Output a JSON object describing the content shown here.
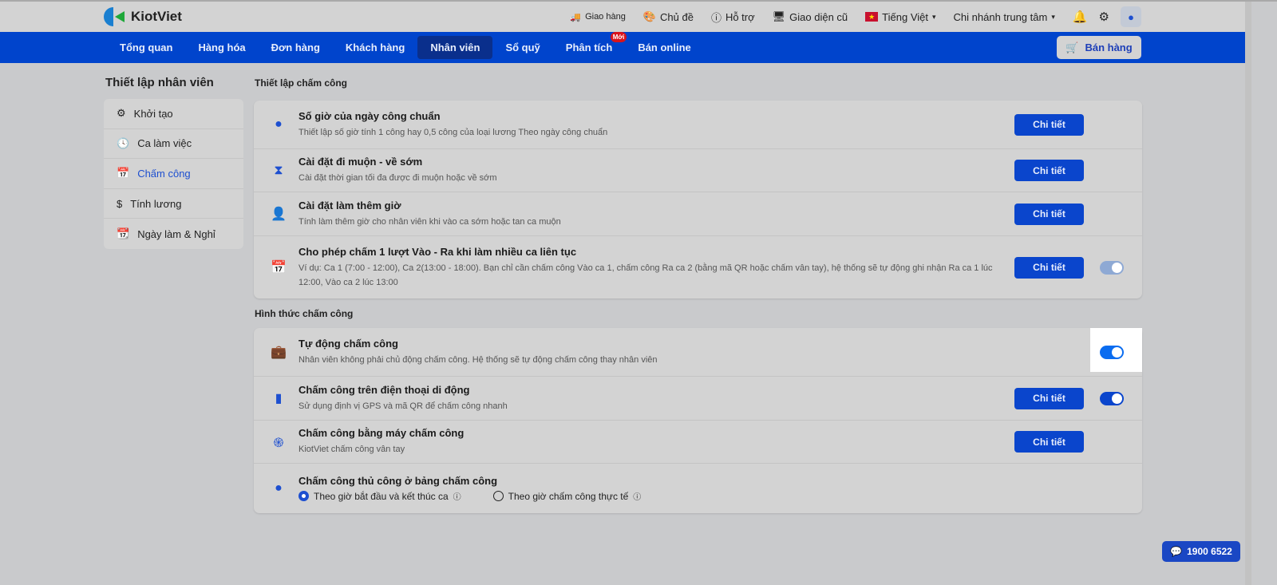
{
  "header": {
    "brand": "KiotViet",
    "delivery": "Giao hàng",
    "theme": "Chủ đề",
    "support": "Hỗ trợ",
    "old_ui": "Giao diện cũ",
    "language": "Tiếng Việt",
    "branch": "Chi nhánh trung tâm"
  },
  "nav": {
    "items": [
      {
        "label": "Tổng quan"
      },
      {
        "label": "Hàng hóa"
      },
      {
        "label": "Đơn hàng"
      },
      {
        "label": "Khách hàng"
      },
      {
        "label": "Nhân viên",
        "active": true
      },
      {
        "label": "Sổ quỹ"
      },
      {
        "label": "Phân tích",
        "badge": "Mới"
      },
      {
        "label": "Bán online"
      }
    ],
    "sell_button": "Bán hàng"
  },
  "sidebar": {
    "title": "Thiết lập nhân viên",
    "items": [
      {
        "label": "Khởi tạo"
      },
      {
        "label": "Ca làm việc"
      },
      {
        "label": "Chấm công",
        "active": true
      },
      {
        "label": "Tính lương"
      },
      {
        "label": "Ngày làm & Nghỉ"
      }
    ]
  },
  "section1": {
    "title": "Thiết lập chấm công",
    "rows": [
      {
        "title": "Số giờ của ngày công chuẩn",
        "desc": "Thiết lập số giờ tính 1 công hay 0,5 công của loại lương Theo ngày công chuẩn",
        "button": "Chi tiết"
      },
      {
        "title": "Cài đặt đi muộn - về sớm",
        "desc": "Cài đặt thời gian tối đa được đi muộn hoặc về sớm",
        "button": "Chi tiết"
      },
      {
        "title": "Cài đặt làm thêm giờ",
        "desc": "Tính làm thêm giờ cho nhân viên khi vào ca sớm hoặc tan ca muộn",
        "button": "Chi tiết"
      },
      {
        "title": "Cho phép chấm 1 lượt Vào - Ra khi làm nhiều ca liên tục",
        "desc": "Ví dụ: Ca 1 (7:00 - 12:00), Ca 2(13:00 - 18:00). Bạn chỉ cần chấm công Vào ca 1, chấm công Ra ca 2 (bằng mã QR hoặc chấm vân tay), hệ thống sẽ tự động ghi nhận Ra ca 1 lúc 12:00, Vào ca 2 lúc 13:00",
        "button": "Chi tiết",
        "toggle": "on-disabled"
      }
    ]
  },
  "section2": {
    "title": "Hình thức chấm công",
    "rows": [
      {
        "title": "Tự động chấm công",
        "desc": "Nhân viên không phải chủ động chấm công. Hệ thống sẽ tự động chấm công thay nhân viên",
        "toggle": "on"
      },
      {
        "title": "Chấm công trên điện thoại di động",
        "desc": "Sử dụng định vị GPS và mã QR để chấm công nhanh",
        "button": "Chi tiết",
        "toggle": "on"
      },
      {
        "title": "Chấm công bằng máy chấm công",
        "desc": "KiotViet chấm công vân tay",
        "button": "Chi tiết"
      },
      {
        "title": "Chấm công thủ công ở bảng chấm công",
        "options": [
          "Theo giờ bắt đầu và kết thúc ca",
          "Theo giờ chấm công thực tế"
        ],
        "selected": 0
      }
    ]
  },
  "hotline": "1900 6522",
  "colors": {
    "primary": "#0044cc",
    "active_nav": "#0a2f8c",
    "toggle_highlight": "#0a6cf0"
  }
}
